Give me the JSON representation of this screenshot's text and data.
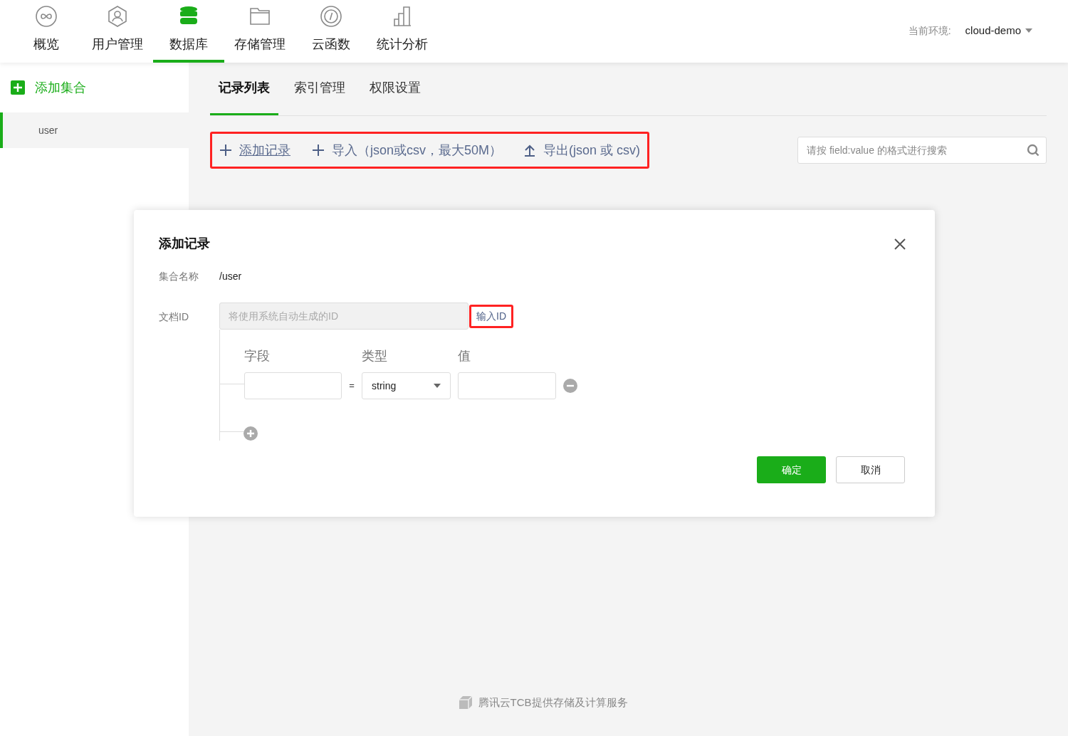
{
  "nav": [
    {
      "label": "概览",
      "kind": "infinity",
      "selected": false
    },
    {
      "label": "用户管理",
      "kind": "user",
      "selected": false
    },
    {
      "label": "数据库",
      "kind": "database",
      "selected": true
    },
    {
      "label": "存储管理",
      "kind": "folder",
      "selected": false
    },
    {
      "label": "云函数",
      "kind": "code",
      "selected": false
    },
    {
      "label": "统计分析",
      "kind": "chart",
      "selected": false
    }
  ],
  "env": {
    "label": "当前环境:",
    "value": "cloud-demo"
  },
  "sidebar": {
    "add_label": "添加集合",
    "items": [
      {
        "label": "user",
        "selected": true
      }
    ]
  },
  "tabs": [
    {
      "label": "记录列表",
      "selected": true
    },
    {
      "label": "索引管理",
      "selected": false
    },
    {
      "label": "权限设置",
      "selected": false
    }
  ],
  "toolbar": {
    "highlighted": true,
    "actions": [
      {
        "kind": "plus",
        "label": "添加记录",
        "underlined": true
      },
      {
        "kind": "plus",
        "label": "导入（json或csv，最大50M）",
        "underlined": false
      },
      {
        "kind": "upload",
        "label": "导出(json 或 csv)",
        "underlined": false
      }
    ]
  },
  "search": {
    "placeholder": "请按 field:value 的格式进行搜索"
  },
  "dialog": {
    "title": "添加记录",
    "collection_label": "集合名称",
    "collection_value": "/user",
    "doc_id_label": "文档ID",
    "doc_id_placeholder": "将使用系统自动生成的ID",
    "input_id_link": "输入ID",
    "input_id_highlighted": true,
    "columns": [
      "字段",
      "类型",
      "值"
    ],
    "equals": "=",
    "type_value": "string",
    "confirm": "确定",
    "cancel": "取消"
  },
  "footer": "腾讯云TCB提供存储及计算服务"
}
